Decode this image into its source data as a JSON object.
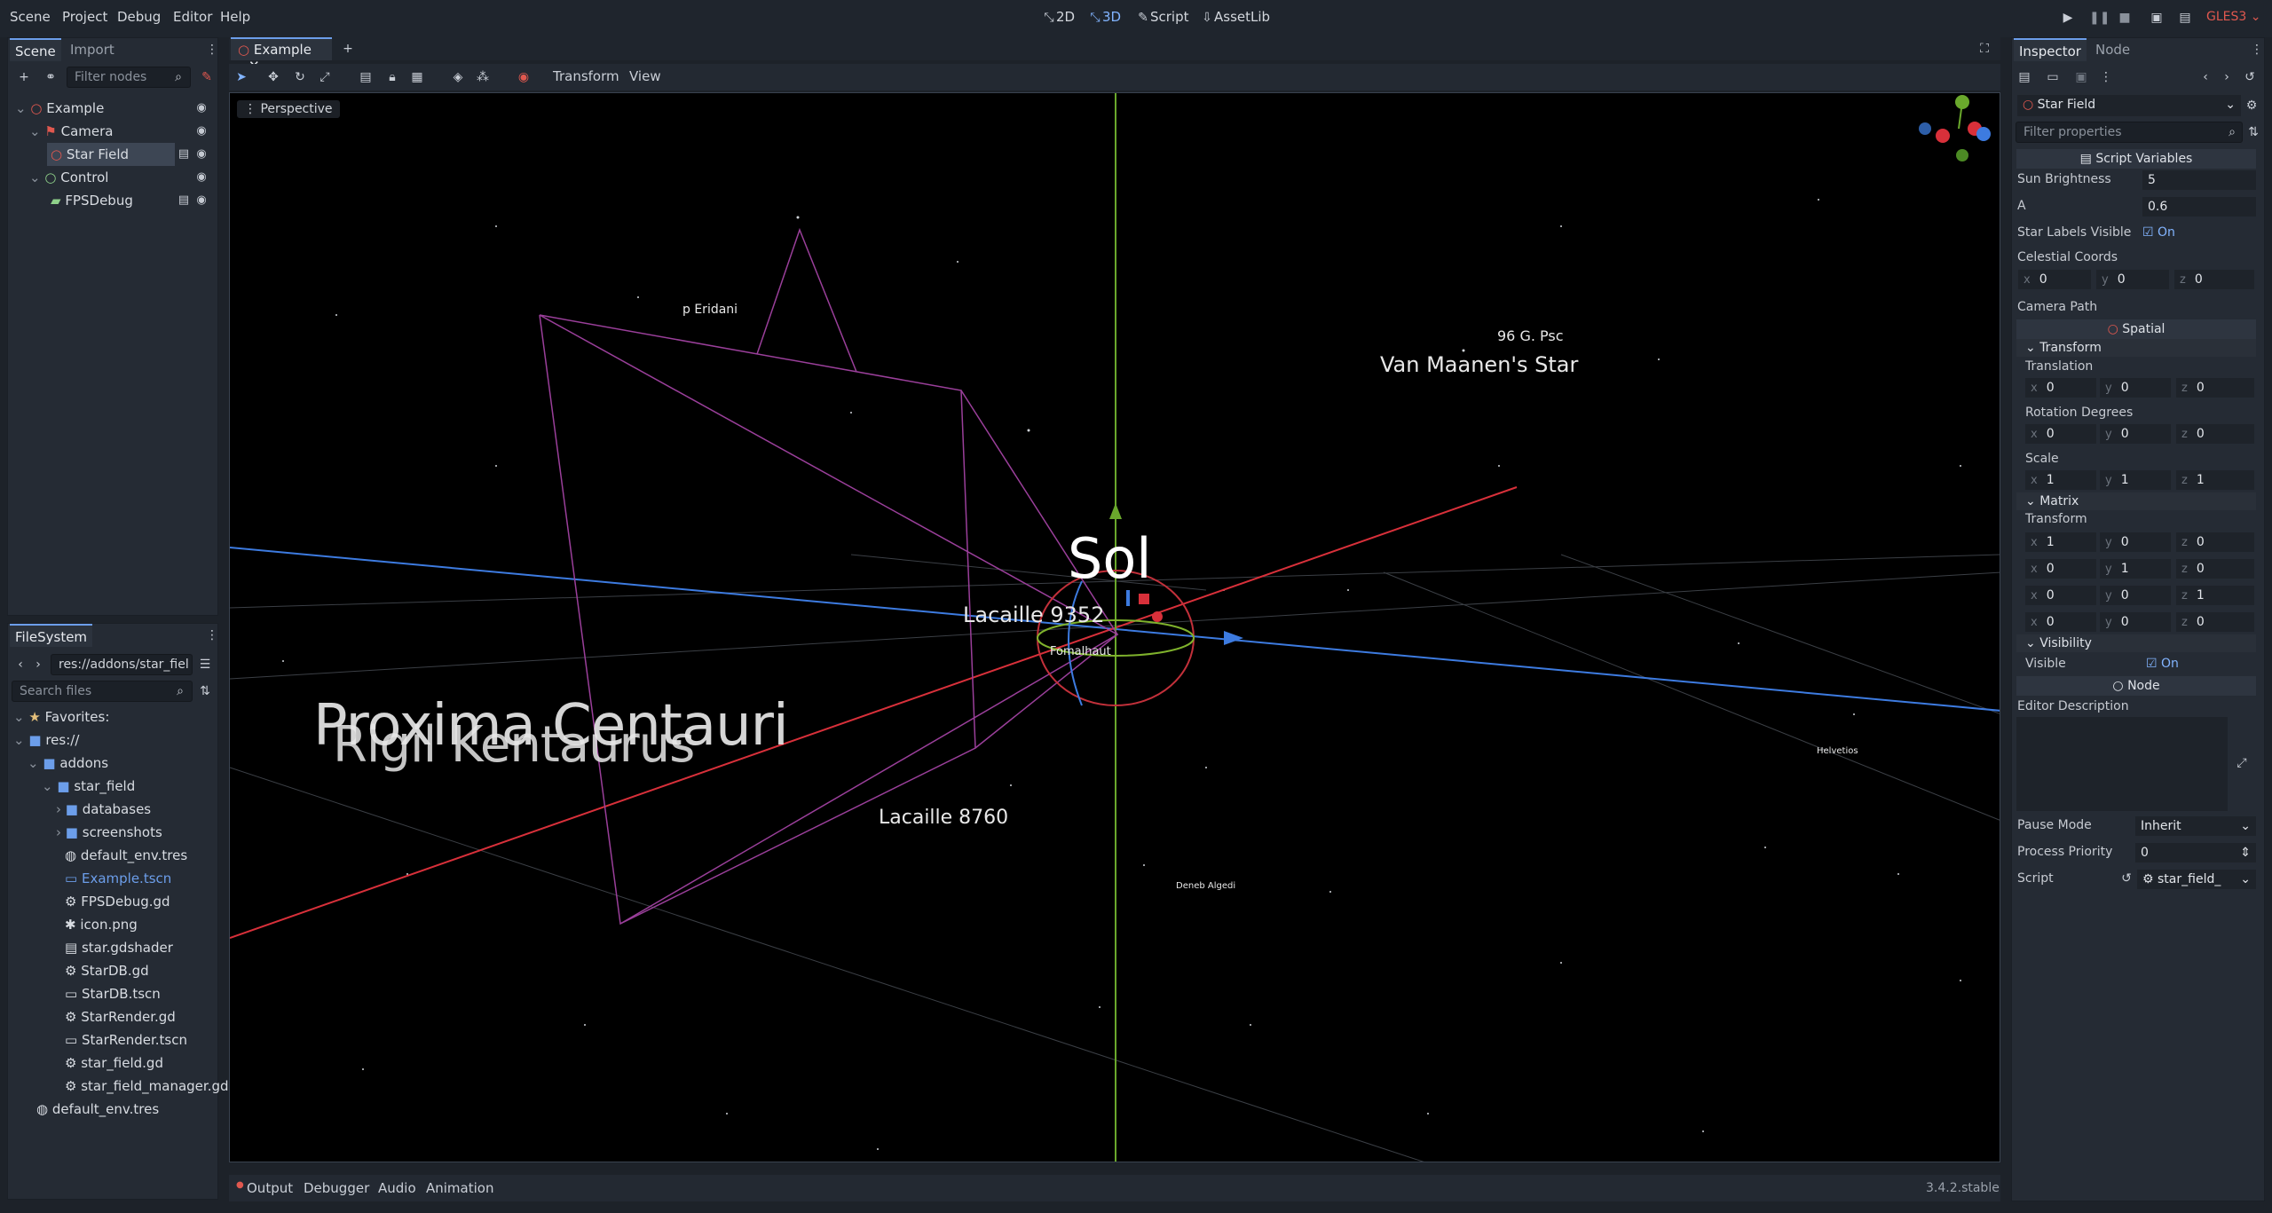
{
  "menu": {
    "items": [
      "Scene",
      "Project",
      "Debug",
      "Editor",
      "Help"
    ]
  },
  "main_screens": {
    "items": [
      "2D",
      "3D",
      "Script",
      "AssetLib"
    ],
    "active": "3D"
  },
  "renderer": "GLES3",
  "scene_dock": {
    "tabs": [
      "Scene",
      "Import"
    ],
    "filter_placeholder": "Filter nodes",
    "nodes": [
      {
        "name": "Example"
      },
      {
        "name": "Camera"
      },
      {
        "name": "Star Field"
      },
      {
        "name": "Control"
      },
      {
        "name": "FPSDebug"
      }
    ]
  },
  "filesystem_dock": {
    "title": "FileSystem",
    "path": "res://addons/star_fiel",
    "search_placeholder": "Search files",
    "items": [
      "Favorites:",
      "res://",
      "addons",
      "star_field",
      "databases",
      "screenshots",
      "default_env.tres",
      "Example.tscn",
      "FPSDebug.gd",
      "icon.png",
      "star.gdshader",
      "StarDB.gd",
      "StarDB.tscn",
      "StarRender.gd",
      "StarRender.tscn",
      "star_field.gd",
      "star_field_manager.gd",
      "default_env.tres"
    ]
  },
  "editor_tabs": {
    "active": "Example"
  },
  "viewport_toolbar": {
    "transform": "Transform",
    "view": "View",
    "perspective": "Perspective"
  },
  "star_labels": {
    "sol": "Sol",
    "lacaille9352": "Lacaille 9352",
    "fomalhaut": "Fomalhaut",
    "vanmaanen": "Van Maanen's Star",
    "g96psc": "96 G. Psc",
    "peridani": "p Eridani",
    "proxima": "Proxima Centauri",
    "rigil": "Rigil Kentaurus",
    "lacaille8760": "Lacaille 8760",
    "deneb": "Deneb Algedi",
    "helvetios": "Helvetios"
  },
  "inspector": {
    "tabs": [
      "Inspector",
      "Node"
    ],
    "object": "Star Field",
    "filter_placeholder": "Filter properties",
    "script_variables": "Script Variables",
    "sun_brightness": {
      "label": "Sun Brightness",
      "value": "5"
    },
    "a": {
      "label": "A",
      "value": "0.6"
    },
    "star_labels_visible": {
      "label": "Star Labels Visible",
      "value": "On"
    },
    "celestial_coords": {
      "label": "Celestial Coords",
      "x": "0",
      "y": "0",
      "z": "0"
    },
    "camera_path": "Camera Path",
    "spatial": "Spatial",
    "transform": "Transform",
    "translation": {
      "label": "Translation",
      "x": "0",
      "y": "0",
      "z": "0"
    },
    "rotation": {
      "label": "Rotation Degrees",
      "x": "0",
      "y": "0",
      "z": "0"
    },
    "scale": {
      "label": "Scale",
      "x": "1",
      "y": "1",
      "z": "1"
    },
    "matrix": "Matrix",
    "matrix_transform": "Transform",
    "matrix_rows": [
      {
        "x": "1",
        "y": "0",
        "z": "0"
      },
      {
        "x": "0",
        "y": "1",
        "z": "0"
      },
      {
        "x": "0",
        "y": "0",
        "z": "1"
      },
      {
        "x": "0",
        "y": "0",
        "z": "0"
      }
    ],
    "visibility": "Visibility",
    "visible": {
      "label": "Visible",
      "value": "On"
    },
    "node": "Node",
    "editor_description": "Editor Description",
    "pause_mode": {
      "label": "Pause Mode",
      "value": "Inherit"
    },
    "process_priority": {
      "label": "Process Priority",
      "value": "0"
    },
    "script": {
      "label": "Script",
      "value": "star_field_"
    }
  },
  "bottom_panel": {
    "tabs": [
      "Output",
      "Debugger",
      "Audio",
      "Animation"
    ],
    "version": "3.4.2.stable"
  }
}
